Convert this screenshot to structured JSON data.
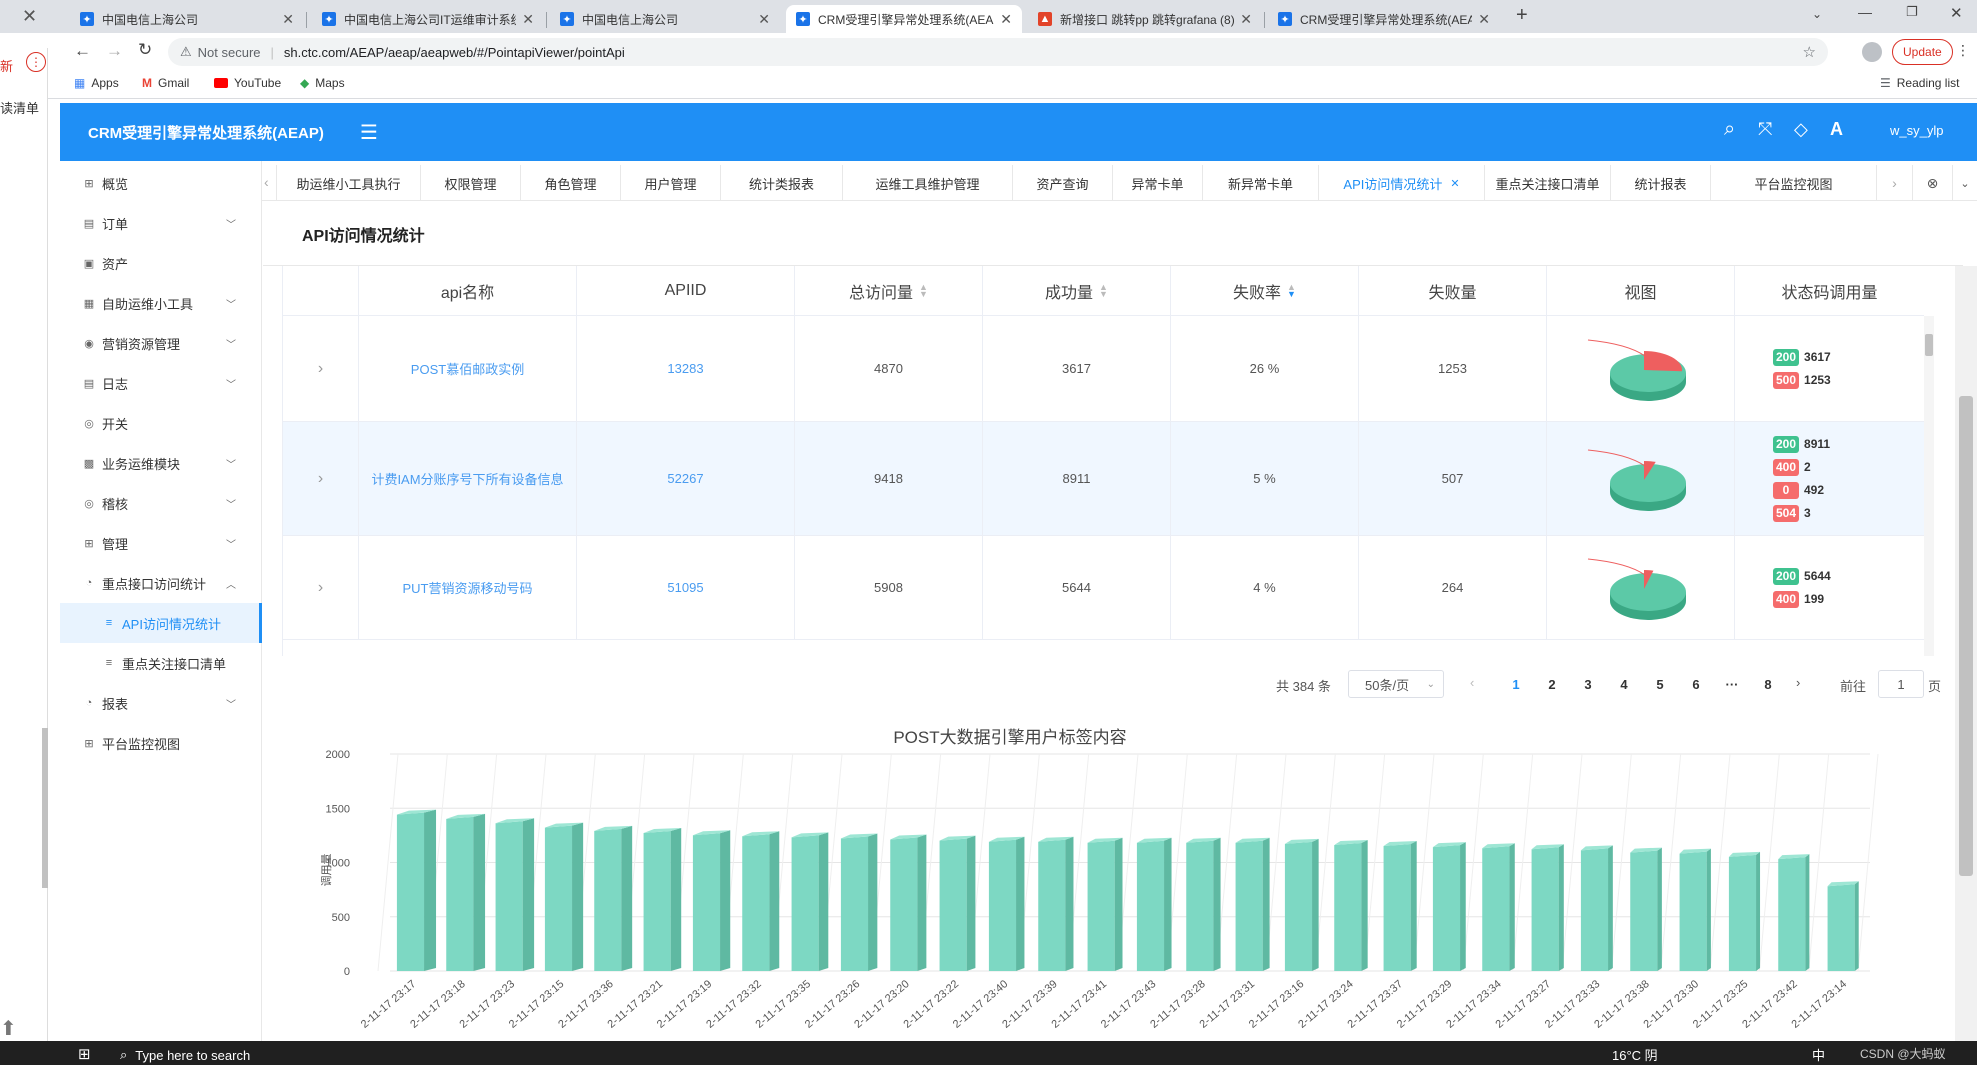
{
  "browser": {
    "tabs": [
      {
        "title": "中国电信上海公司",
        "active": false,
        "icon": "telecom-icon"
      },
      {
        "title": "中国电信上海公司IT运维审计系统",
        "active": false,
        "icon": "telecom-icon"
      },
      {
        "title": "中国电信上海公司",
        "active": false,
        "icon": "telecom-icon"
      },
      {
        "title": "CRM受理引擎异常处理系统(AEAP)",
        "active": true,
        "icon": "gear-icon"
      },
      {
        "title": "新增接口 跳转pp 跳转grafana (8)",
        "active": false,
        "icon": "gitlab-icon"
      },
      {
        "title": "CRM受理引擎异常处理系统(AEAP)",
        "active": false,
        "icon": "gear-icon"
      }
    ],
    "security": "Not secure",
    "url": "sh.ctc.com/AEAP/aeap/aeapweb/#/PointapiViewer/pointApi",
    "update_label": "Update",
    "reading_list": "Reading list",
    "bookmarks": [
      "Apps",
      "Gmail",
      "YouTube",
      "Maps"
    ]
  },
  "left_edge": {
    "fragment1": "新",
    "fragment2": "读清单"
  },
  "app": {
    "title": "CRM受理引擎异常处理系统(AEAP)",
    "user": "w_sy_ylp"
  },
  "sidebar": {
    "items": [
      {
        "label": "概览",
        "icon": "dashboard-icon",
        "chevron": false,
        "sub": false,
        "active": false
      },
      {
        "label": "订单",
        "icon": "order-icon",
        "chevron": "down",
        "sub": false,
        "active": false
      },
      {
        "label": "资产",
        "icon": "asset-icon",
        "chevron": false,
        "sub": false,
        "active": false
      },
      {
        "label": "自助运维小工具",
        "icon": "tool-icon",
        "chevron": "down",
        "sub": false,
        "active": false
      },
      {
        "label": "营销资源管理",
        "icon": "resource-icon",
        "chevron": "down",
        "sub": false,
        "active": false
      },
      {
        "label": "日志",
        "icon": "log-icon",
        "chevron": "down",
        "sub": false,
        "active": false
      },
      {
        "label": "开关",
        "icon": "switch-icon",
        "chevron": false,
        "sub": false,
        "active": false
      },
      {
        "label": "业务运维模块",
        "icon": "module-icon",
        "chevron": "down",
        "sub": false,
        "active": false
      },
      {
        "label": "稽核",
        "icon": "audit-icon",
        "chevron": "down",
        "sub": false,
        "active": false
      },
      {
        "label": "管理",
        "icon": "manage-icon",
        "chevron": "down",
        "sub": false,
        "active": false
      },
      {
        "label": "重点接口访问统计",
        "icon": "piechart-icon",
        "chevron": "up",
        "sub": false,
        "active": false
      },
      {
        "label": "API访问情况统计",
        "icon": "list-icon",
        "chevron": false,
        "sub": true,
        "active": true
      },
      {
        "label": "重点关注接口清单",
        "icon": "list-icon",
        "chevron": false,
        "sub": true,
        "active": false
      },
      {
        "label": "报表",
        "icon": "piechart-icon",
        "chevron": "down",
        "sub": false,
        "active": false
      },
      {
        "label": "平台监控视图",
        "icon": "grid-icon",
        "chevron": false,
        "sub": false,
        "active": false
      }
    ]
  },
  "tags": [
    "助运维小工具执行",
    "权限管理",
    "角色管理",
    "用户管理",
    "统计类报表",
    "运维工具维护管理",
    "资产查询",
    "异常卡单",
    "新异常卡单",
    "API访问情况统计",
    "重点关注接口清单",
    "统计报表",
    "平台监控视图"
  ],
  "active_tag": "API访问情况统计",
  "page": {
    "title": "API访问情况统计"
  },
  "table": {
    "columns": [
      "",
      "api名称",
      "APIID",
      "总访问量",
      "成功量",
      "失败率",
      "失败量",
      "视图",
      "状态码调用量"
    ],
    "rows": [
      {
        "name": "POST慕佰邮政实例",
        "apiid": "13283",
        "total": "4870",
        "success": "3617",
        "fail_rate": "26 %",
        "fail": "1253",
        "pie_fail_fraction": 0.26,
        "codes": [
          {
            "code": "200",
            "count": "3617"
          },
          {
            "code": "500",
            "count": "1253"
          }
        ]
      },
      {
        "name": "计费IAM分账序号下所有设备信息",
        "apiid": "52267",
        "total": "9418",
        "success": "8911",
        "fail_rate": "5 %",
        "fail": "507",
        "pie_fail_fraction": 0.05,
        "codes": [
          {
            "code": "200",
            "count": "8911"
          },
          {
            "code": "400",
            "count": "2"
          },
          {
            "code": "0",
            "count": "492"
          },
          {
            "code": "504",
            "count": "3"
          }
        ]
      },
      {
        "name": "PUT营销资源移动号码",
        "apiid": "51095",
        "total": "5908",
        "success": "5644",
        "fail_rate": "4 %",
        "fail": "264",
        "pie_fail_fraction": 0.04,
        "codes": [
          {
            "code": "200",
            "count": "5644"
          },
          {
            "code": "400",
            "count": "199"
          }
        ]
      }
    ]
  },
  "pagination": {
    "total_text": "共 384 条",
    "page_size": "50条/页",
    "pages": [
      "1",
      "2",
      "3",
      "4",
      "5",
      "6",
      "···",
      "8"
    ],
    "current": "1",
    "goto_prefix": "前往",
    "goto_value": "1",
    "goto_suffix": "页"
  },
  "chart_data": {
    "type": "bar",
    "title": "POST大数据引擎用户标签内容",
    "ylabel": "调用量",
    "xlabel": "",
    "ylim": [
      0,
      2000
    ],
    "yticks": [
      0,
      500,
      1000,
      1500,
      2000
    ],
    "grid": true,
    "color": "#7dd8c3",
    "categories": [
      "2-11-17 23:17",
      "2-11-17 23:18",
      "2-11-17 23:23",
      "2-11-17 23:15",
      "2-11-17 23:36",
      "2-11-17 23:21",
      "2-11-17 23:19",
      "2-11-17 23:32",
      "2-11-17 23:35",
      "2-11-17 23:26",
      "2-11-17 23:20",
      "2-11-17 23:22",
      "2-11-17 23:40",
      "2-11-17 23:39",
      "2-11-17 23:41",
      "2-11-17 23:43",
      "2-11-17 23:28",
      "2-11-17 23:31",
      "2-11-17 23:16",
      "2-11-17 23:24",
      "2-11-17 23:37",
      "2-11-17 23:29",
      "2-11-17 23:34",
      "2-11-17 23:27",
      "2-11-17 23:33",
      "2-11-17 23:38",
      "2-11-17 23:30",
      "2-11-17 23:25",
      "2-11-17 23:42",
      "2-11-17 23:14"
    ],
    "values": [
      1460,
      1420,
      1380,
      1340,
      1310,
      1290,
      1270,
      1260,
      1250,
      1240,
      1230,
      1220,
      1210,
      1210,
      1200,
      1200,
      1200,
      1200,
      1190,
      1180,
      1170,
      1160,
      1150,
      1140,
      1130,
      1110,
      1100,
      1070,
      1050,
      800
    ]
  },
  "taskbar": {
    "search_placeholder": "Type here to search",
    "weather": "16°C 阴",
    "ime": "中",
    "corner": "CSDN @大蚂蚁"
  }
}
